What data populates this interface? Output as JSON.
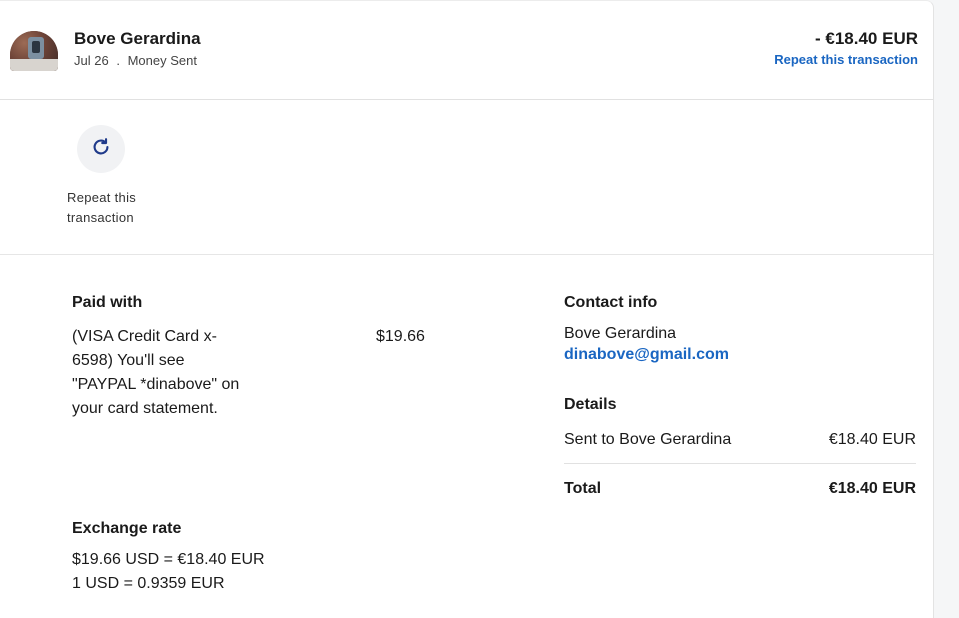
{
  "header": {
    "name": "Bove Gerardina",
    "date": "Jul 26",
    "separator": ".",
    "type": "Money Sent",
    "amount": "- €18.40 EUR",
    "repeat_link": "Repeat this transaction"
  },
  "actions": {
    "repeat_label": "Repeat this transaction",
    "repeat_icon": "refresh-icon"
  },
  "paid_with": {
    "title": "Paid with",
    "description": "(VISA Credit Card x-6598) You'll see \"PAYPAL *dinabove\" on your card statement.",
    "amount": "$19.66"
  },
  "exchange_rate": {
    "title": "Exchange rate",
    "line1": "$19.66 USD = €18.40 EUR",
    "line2": "1 USD = 0.9359 EUR"
  },
  "contact": {
    "title": "Contact info",
    "name": "Bove Gerardina",
    "email": "dinabove@gmail.com"
  },
  "details": {
    "title": "Details",
    "sent_label": "Sent to Bove Gerardina",
    "sent_value": "€18.40 EUR",
    "total_label": "Total",
    "total_value": "€18.40 EUR"
  },
  "colors": {
    "link": "#1a66c2",
    "icon": "#1f3a8a"
  }
}
